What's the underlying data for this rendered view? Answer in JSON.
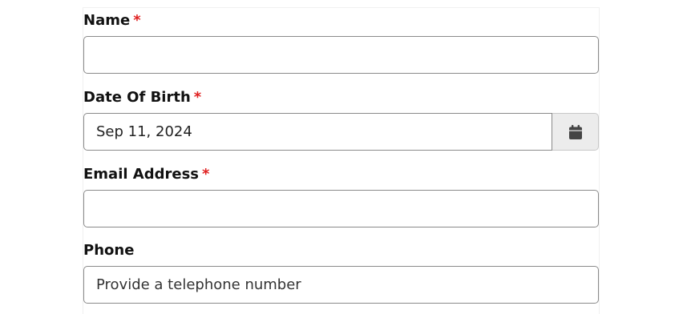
{
  "form": {
    "name": {
      "label": "Name",
      "required_marker": "*",
      "value": "",
      "placeholder": ""
    },
    "date_of_birth": {
      "label": "Date Of Birth",
      "required_marker": "*",
      "value": "Sep 11, 2024",
      "button_icon": "calendar-icon"
    },
    "email": {
      "label": "Email Address",
      "required_marker": "*",
      "value": "",
      "placeholder": ""
    },
    "phone": {
      "label": "Phone",
      "value": "",
      "placeholder": "Provide a telephone number"
    }
  },
  "colors": {
    "required": "#e02020",
    "input_border": "#8a8a8a",
    "calendar_button_bg": "#ececec",
    "icon": "#444444"
  }
}
